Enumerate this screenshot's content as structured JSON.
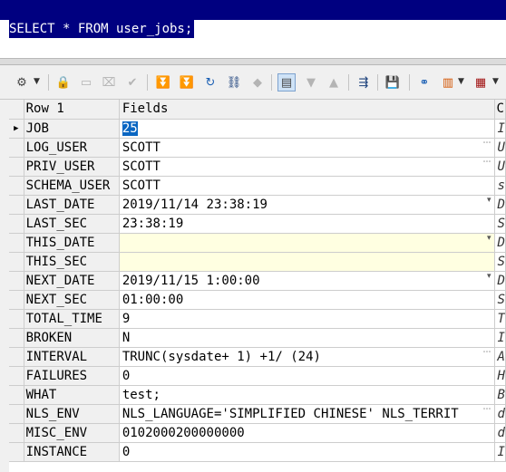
{
  "editor": {
    "sql": "SELECT * FROM user_jobs;"
  },
  "toolbar": {
    "icons": [
      "query-options-icon",
      "lock-icon",
      "insert-record-icon",
      "delete-record-icon",
      "post-icon",
      "first-record-icon",
      "last-record-icon",
      "refresh-icon",
      "find-icon",
      "clear-icon",
      "single-record-view-icon",
      "next-icon",
      "previous-icon",
      "export-icon",
      "save-icon",
      "link-icon",
      "chart-icon",
      "grid-options-icon"
    ]
  },
  "grid": {
    "header": {
      "row_label": "Row 1",
      "fields_label": "Fields",
      "comment_label": "C"
    },
    "rows": [
      {
        "name": "JOB",
        "value": "25",
        "comment": "I"
      },
      {
        "name": "LOG_USER",
        "value": "SCOTT",
        "comment": "U"
      },
      {
        "name": "PRIV_USER",
        "value": "SCOTT",
        "comment": "U"
      },
      {
        "name": "SCHEMA_USER",
        "value": "SCOTT",
        "comment": "s"
      },
      {
        "name": "LAST_DATE",
        "value": "2019/11/14 23:38:19",
        "comment": "D"
      },
      {
        "name": "LAST_SEC",
        "value": "23:38:19",
        "comment": "S"
      },
      {
        "name": "THIS_DATE",
        "value": "",
        "comment": "D"
      },
      {
        "name": "THIS_SEC",
        "value": "",
        "comment": "S"
      },
      {
        "name": "NEXT_DATE",
        "value": "2019/11/15 1:00:00",
        "comment": "D"
      },
      {
        "name": "NEXT_SEC",
        "value": "01:00:00",
        "comment": "S"
      },
      {
        "name": "TOTAL_TIME",
        "value": "9",
        "comment": "T"
      },
      {
        "name": "BROKEN",
        "value": "N",
        "comment": "I"
      },
      {
        "name": "INTERVAL",
        "value": "TRUNC(sysdate+ 1)  +1/ (24)",
        "comment": "A"
      },
      {
        "name": "FAILURES",
        "value": "0",
        "comment": "H"
      },
      {
        "name": "WHAT",
        "value": "test;",
        "comment": "B"
      },
      {
        "name": "NLS_ENV",
        "value": "NLS_LANGUAGE='SIMPLIFIED CHINESE' NLS_TERRIT",
        "comment": "d"
      },
      {
        "name": "MISC_ENV",
        "value": "0102000200000000",
        "comment": "d"
      },
      {
        "name": "INSTANCE",
        "value": "0",
        "comment": "I"
      }
    ]
  }
}
